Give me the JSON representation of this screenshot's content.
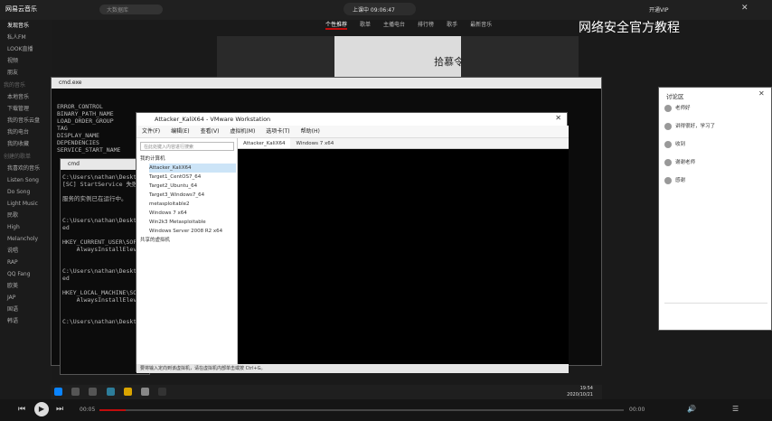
{
  "app": {
    "logo": "网易云音乐",
    "search_placeholder": "大数据库",
    "user_status": "上课中 09:06:47",
    "vip": "开通VIP"
  },
  "top_tabs": [
    "个性推荐",
    "歌单",
    "主播电台",
    "排行榜",
    "歌手",
    "最新音乐"
  ],
  "banner": {
    "title": "拾慕令"
  },
  "overlay_title": "网络安全官方教程",
  "sidebar": {
    "items": [
      "发现音乐",
      "私人FM",
      "LOOK直播",
      "视频",
      "朋友"
    ],
    "my_music_head": "我的音乐",
    "my_music": [
      "本地音乐",
      "下载管理",
      "我的音乐云盘",
      "我的电台",
      "我的收藏"
    ],
    "playlists_head": "创建的歌单",
    "playlists": [
      "我喜欢的音乐",
      "Listen Song",
      "Do Song",
      "Light Music",
      "民歌",
      "High",
      "Melancholy",
      "说唱",
      "RAP",
      "QQ Fang",
      "欧美",
      "JAP",
      "国语",
      "韩语"
    ]
  },
  "cmd1": {
    "title": "cmd.exe",
    "lines": [
      "ERROR_CONTROL",
      "BINARY_PATH_NAME",
      "LOAD_ORDER_GROUP",
      "TAG",
      "DISPLAY_NAME",
      "DEPENDENCIES",
      "SERVICE_START_NAME"
    ]
  },
  "cmd2": {
    "title": "cmd",
    "lines": [
      "C:\\Users\\nathan\\Desktop",
      "[SC] StartService 失败",
      "",
      "服务的实例已在运行中。",
      "",
      "",
      "C:\\Users\\nathan\\Desktop",
      "ed",
      "",
      "HKEY_CURRENT_USER\\SOFTW",
      "    AlwaysInstallElevat",
      "",
      "",
      "C:\\Users\\nathan\\Desktop",
      "ed",
      "",
      "HKEY_LOCAL_MACHINE\\SOFT",
      "    AlwaysInstallElevat",
      "",
      "",
      "C:\\Users\\nathan\\Desktop"
    ]
  },
  "vmware": {
    "title": "Attacker_KaliX64 - VMware Workstation",
    "menu": [
      "文件(F)",
      "编辑(E)",
      "查看(V)",
      "虚拟机(M)",
      "选项卡(T)",
      "帮助(H)"
    ],
    "library_search": "在此处键入内容进行搜索",
    "library_root": "我的计算机",
    "vms": [
      "Attacker_KaliX64",
      "Target1_CentOS7_64",
      "Target2_Ubuntu_64",
      "Target3_Windows7_64",
      "metasploitable2",
      "Windows 7 x64",
      "Win2k3 Metasploitable",
      "Windows Server 2008 R2 x64"
    ],
    "shared": "共享的虚拟机",
    "tabs": [
      "Attacker_KaliX64",
      "Windows 7 x64"
    ],
    "status": "要将输入定向到该虚拟机，请在虚拟机内部单击或按 Ctrl+G。"
  },
  "chat": {
    "title": "讨论区",
    "messages": [
      "老师好",
      "讲得很好，学习了",
      "收到",
      "谢谢老师",
      "感谢"
    ]
  },
  "player": {
    "time_current": "00:05",
    "time_total": "00:00"
  },
  "taskbar": {
    "time": "19:54",
    "date": "2020/10/21"
  },
  "colors": {
    "accent": "#c20c0c",
    "vm_bg": "#f0f0f0"
  }
}
